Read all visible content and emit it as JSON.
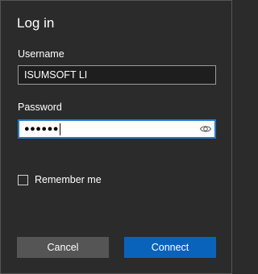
{
  "dialog": {
    "title": "Log in"
  },
  "username": {
    "label": "Username",
    "value": "ISUMSOFT LI"
  },
  "password": {
    "label": "Password",
    "masked_value": "●●●●●●",
    "reveal_icon": "eye-icon"
  },
  "remember": {
    "label": "Remember me",
    "checked": false
  },
  "buttons": {
    "cancel_label": "Cancel",
    "connect_label": "Connect"
  },
  "colors": {
    "background": "#2b2b2b",
    "accent": "#0a63bb",
    "focus_border": "#1e7ad0",
    "secondary_button": "#555555"
  }
}
